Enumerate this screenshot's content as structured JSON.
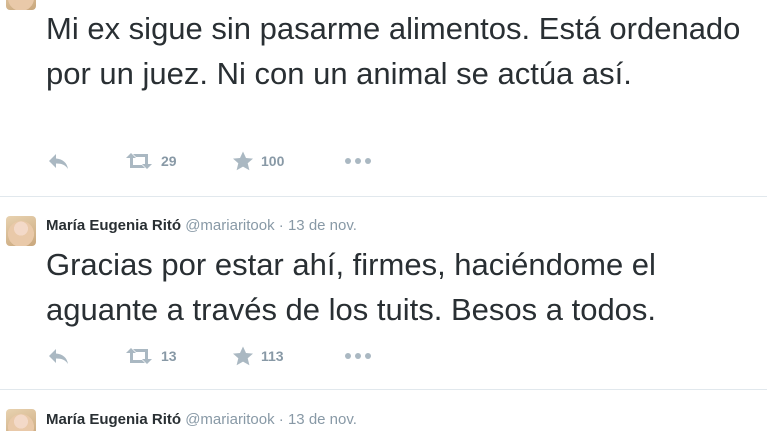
{
  "tweets": [
    {
      "text": "Mi ex sigue sin pasarme alimentos. Está ordenado por un juez. Ni con un animal se actúa así.",
      "retweets": "29",
      "favorites": "100"
    },
    {
      "name": "María Eugenia Ritó",
      "handle": "@mariaritook",
      "separator": "·",
      "date": "13 de nov.",
      "text": "Gracias por estar ahí, firmes, haciéndome el aguante a través de los tuits. Besos a todos.",
      "retweets": "13",
      "favorites": "113"
    },
    {
      "name": "María Eugenia Ritó",
      "handle": "@mariaritook",
      "separator": "·",
      "date": "13 de nov."
    }
  ],
  "icons": {
    "reply": "reply-icon",
    "retweet": "retweet-icon",
    "favorite": "star-icon",
    "more": "more-icon"
  },
  "colors": {
    "icon": "#aab8c2",
    "meta": "#8899a6",
    "text": "#292f33",
    "divider": "#e1e8ed"
  }
}
